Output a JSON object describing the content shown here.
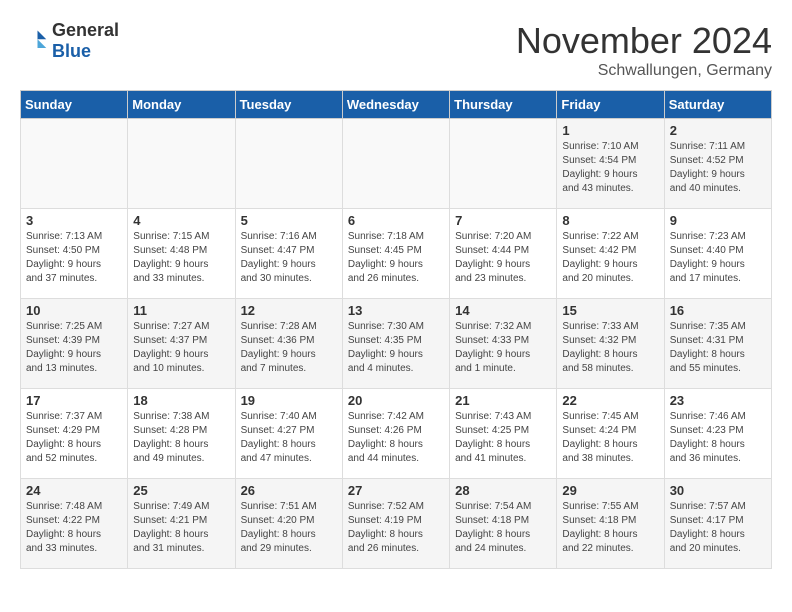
{
  "header": {
    "logo": {
      "general": "General",
      "blue": "Blue"
    },
    "month": "November 2024",
    "location": "Schwallungen, Germany"
  },
  "weekdays": [
    "Sunday",
    "Monday",
    "Tuesday",
    "Wednesday",
    "Thursday",
    "Friday",
    "Saturday"
  ],
  "weeks": [
    [
      {
        "day": "",
        "info": ""
      },
      {
        "day": "",
        "info": ""
      },
      {
        "day": "",
        "info": ""
      },
      {
        "day": "",
        "info": ""
      },
      {
        "day": "",
        "info": ""
      },
      {
        "day": "1",
        "info": "Sunrise: 7:10 AM\nSunset: 4:54 PM\nDaylight: 9 hours\nand 43 minutes."
      },
      {
        "day": "2",
        "info": "Sunrise: 7:11 AM\nSunset: 4:52 PM\nDaylight: 9 hours\nand 40 minutes."
      }
    ],
    [
      {
        "day": "3",
        "info": "Sunrise: 7:13 AM\nSunset: 4:50 PM\nDaylight: 9 hours\nand 37 minutes."
      },
      {
        "day": "4",
        "info": "Sunrise: 7:15 AM\nSunset: 4:48 PM\nDaylight: 9 hours\nand 33 minutes."
      },
      {
        "day": "5",
        "info": "Sunrise: 7:16 AM\nSunset: 4:47 PM\nDaylight: 9 hours\nand 30 minutes."
      },
      {
        "day": "6",
        "info": "Sunrise: 7:18 AM\nSunset: 4:45 PM\nDaylight: 9 hours\nand 26 minutes."
      },
      {
        "day": "7",
        "info": "Sunrise: 7:20 AM\nSunset: 4:44 PM\nDaylight: 9 hours\nand 23 minutes."
      },
      {
        "day": "8",
        "info": "Sunrise: 7:22 AM\nSunset: 4:42 PM\nDaylight: 9 hours\nand 20 minutes."
      },
      {
        "day": "9",
        "info": "Sunrise: 7:23 AM\nSunset: 4:40 PM\nDaylight: 9 hours\nand 17 minutes."
      }
    ],
    [
      {
        "day": "10",
        "info": "Sunrise: 7:25 AM\nSunset: 4:39 PM\nDaylight: 9 hours\nand 13 minutes."
      },
      {
        "day": "11",
        "info": "Sunrise: 7:27 AM\nSunset: 4:37 PM\nDaylight: 9 hours\nand 10 minutes."
      },
      {
        "day": "12",
        "info": "Sunrise: 7:28 AM\nSunset: 4:36 PM\nDaylight: 9 hours\nand 7 minutes."
      },
      {
        "day": "13",
        "info": "Sunrise: 7:30 AM\nSunset: 4:35 PM\nDaylight: 9 hours\nand 4 minutes."
      },
      {
        "day": "14",
        "info": "Sunrise: 7:32 AM\nSunset: 4:33 PM\nDaylight: 9 hours\nand 1 minute."
      },
      {
        "day": "15",
        "info": "Sunrise: 7:33 AM\nSunset: 4:32 PM\nDaylight: 8 hours\nand 58 minutes."
      },
      {
        "day": "16",
        "info": "Sunrise: 7:35 AM\nSunset: 4:31 PM\nDaylight: 8 hours\nand 55 minutes."
      }
    ],
    [
      {
        "day": "17",
        "info": "Sunrise: 7:37 AM\nSunset: 4:29 PM\nDaylight: 8 hours\nand 52 minutes."
      },
      {
        "day": "18",
        "info": "Sunrise: 7:38 AM\nSunset: 4:28 PM\nDaylight: 8 hours\nand 49 minutes."
      },
      {
        "day": "19",
        "info": "Sunrise: 7:40 AM\nSunset: 4:27 PM\nDaylight: 8 hours\nand 47 minutes."
      },
      {
        "day": "20",
        "info": "Sunrise: 7:42 AM\nSunset: 4:26 PM\nDaylight: 8 hours\nand 44 minutes."
      },
      {
        "day": "21",
        "info": "Sunrise: 7:43 AM\nSunset: 4:25 PM\nDaylight: 8 hours\nand 41 minutes."
      },
      {
        "day": "22",
        "info": "Sunrise: 7:45 AM\nSunset: 4:24 PM\nDaylight: 8 hours\nand 38 minutes."
      },
      {
        "day": "23",
        "info": "Sunrise: 7:46 AM\nSunset: 4:23 PM\nDaylight: 8 hours\nand 36 minutes."
      }
    ],
    [
      {
        "day": "24",
        "info": "Sunrise: 7:48 AM\nSunset: 4:22 PM\nDaylight: 8 hours\nand 33 minutes."
      },
      {
        "day": "25",
        "info": "Sunrise: 7:49 AM\nSunset: 4:21 PM\nDaylight: 8 hours\nand 31 minutes."
      },
      {
        "day": "26",
        "info": "Sunrise: 7:51 AM\nSunset: 4:20 PM\nDaylight: 8 hours\nand 29 minutes."
      },
      {
        "day": "27",
        "info": "Sunrise: 7:52 AM\nSunset: 4:19 PM\nDaylight: 8 hours\nand 26 minutes."
      },
      {
        "day": "28",
        "info": "Sunrise: 7:54 AM\nSunset: 4:18 PM\nDaylight: 8 hours\nand 24 minutes."
      },
      {
        "day": "29",
        "info": "Sunrise: 7:55 AM\nSunset: 4:18 PM\nDaylight: 8 hours\nand 22 minutes."
      },
      {
        "day": "30",
        "info": "Sunrise: 7:57 AM\nSunset: 4:17 PM\nDaylight: 8 hours\nand 20 minutes."
      }
    ]
  ]
}
